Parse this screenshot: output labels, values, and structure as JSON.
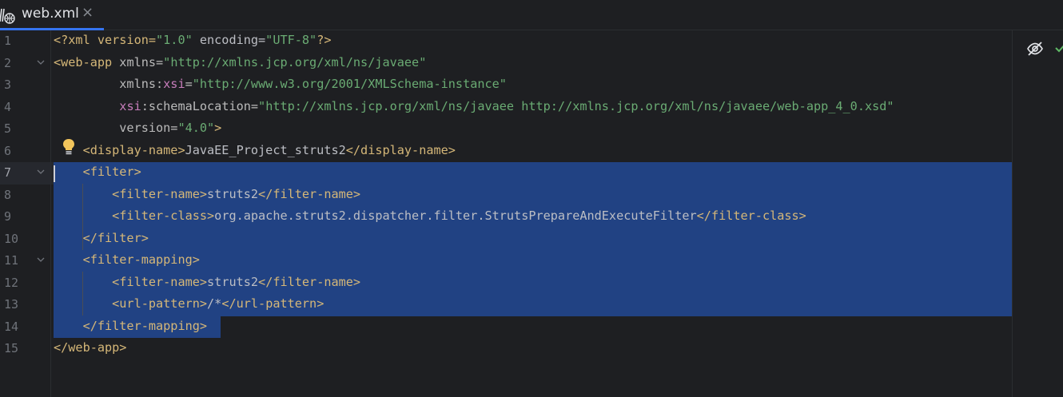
{
  "tab": {
    "label": "web.xml",
    "close": "×"
  },
  "line_numbers": [
    "1",
    "2",
    "3",
    "4",
    "5",
    "6",
    "7",
    "8",
    "9",
    "10",
    "11",
    "12",
    "13",
    "14",
    "15"
  ],
  "code": {
    "l1": {
      "a": "<?xml version=",
      "b": "\"1.0\"",
      "c": " encoding=",
      "d": "\"UTF-8\"",
      "e": "?>"
    },
    "l2": {
      "a": "<web-app",
      "b": " xmlns=",
      "c": "\"http://xmlns.jcp.org/xml/ns/javaee\""
    },
    "l3": {
      "a": "         xmlns:",
      "b": "xsi",
      "c": "=",
      "d": "\"http://www.w3.org/2001/XMLSchema-instance\""
    },
    "l4": {
      "a": "         ",
      "b": "xsi",
      "c": ":schemaLocation=",
      "d": "\"http://xmlns.jcp.org/xml/ns/javaee http://xmlns.jcp.org/xml/ns/javaee/web-app_4_0.xsd\""
    },
    "l5": {
      "a": "         version=",
      "b": "\"4.0\"",
      "c": ">"
    },
    "l6": {
      "a": "    <display-name>",
      "b": "JavaEE_Project_struts2",
      "c": "</display-name>"
    },
    "l7": {
      "a": "    <filter>"
    },
    "l8": {
      "a": "        <filter-name>",
      "b": "struts2",
      "c": "</filter-name>"
    },
    "l9": {
      "a": "        <filter-class>",
      "b": "org.apache.struts2.dispatcher.filter.StrutsPrepareAndExecuteFilter",
      "c": "</filter-class>"
    },
    "l10": {
      "a": "    </filter>"
    },
    "l11": {
      "a": "    <filter-mapping>"
    },
    "l12": {
      "a": "        <filter-name>",
      "b": "struts2",
      "c": "</filter-name>"
    },
    "l13": {
      "a": "        <url-pattern>",
      "b": "/*",
      "c": "</url-pattern>"
    },
    "l14": {
      "a": "    </filter-mapping>"
    },
    "l15": {
      "a": "</web-app>"
    }
  },
  "icons": {
    "tab_file": "xml-file-icon",
    "intention": "lightbulb-icon",
    "reader_mode": "eye-crossed-icon",
    "inspection": "checkmark-icon",
    "fold": "chevron-down-icon"
  },
  "colors": {
    "background": "#1e1f22",
    "selection": "#214283",
    "tag": "#d5b778",
    "string": "#6aab73",
    "namespace": "#c77dbb",
    "accent": "#3574f0"
  }
}
